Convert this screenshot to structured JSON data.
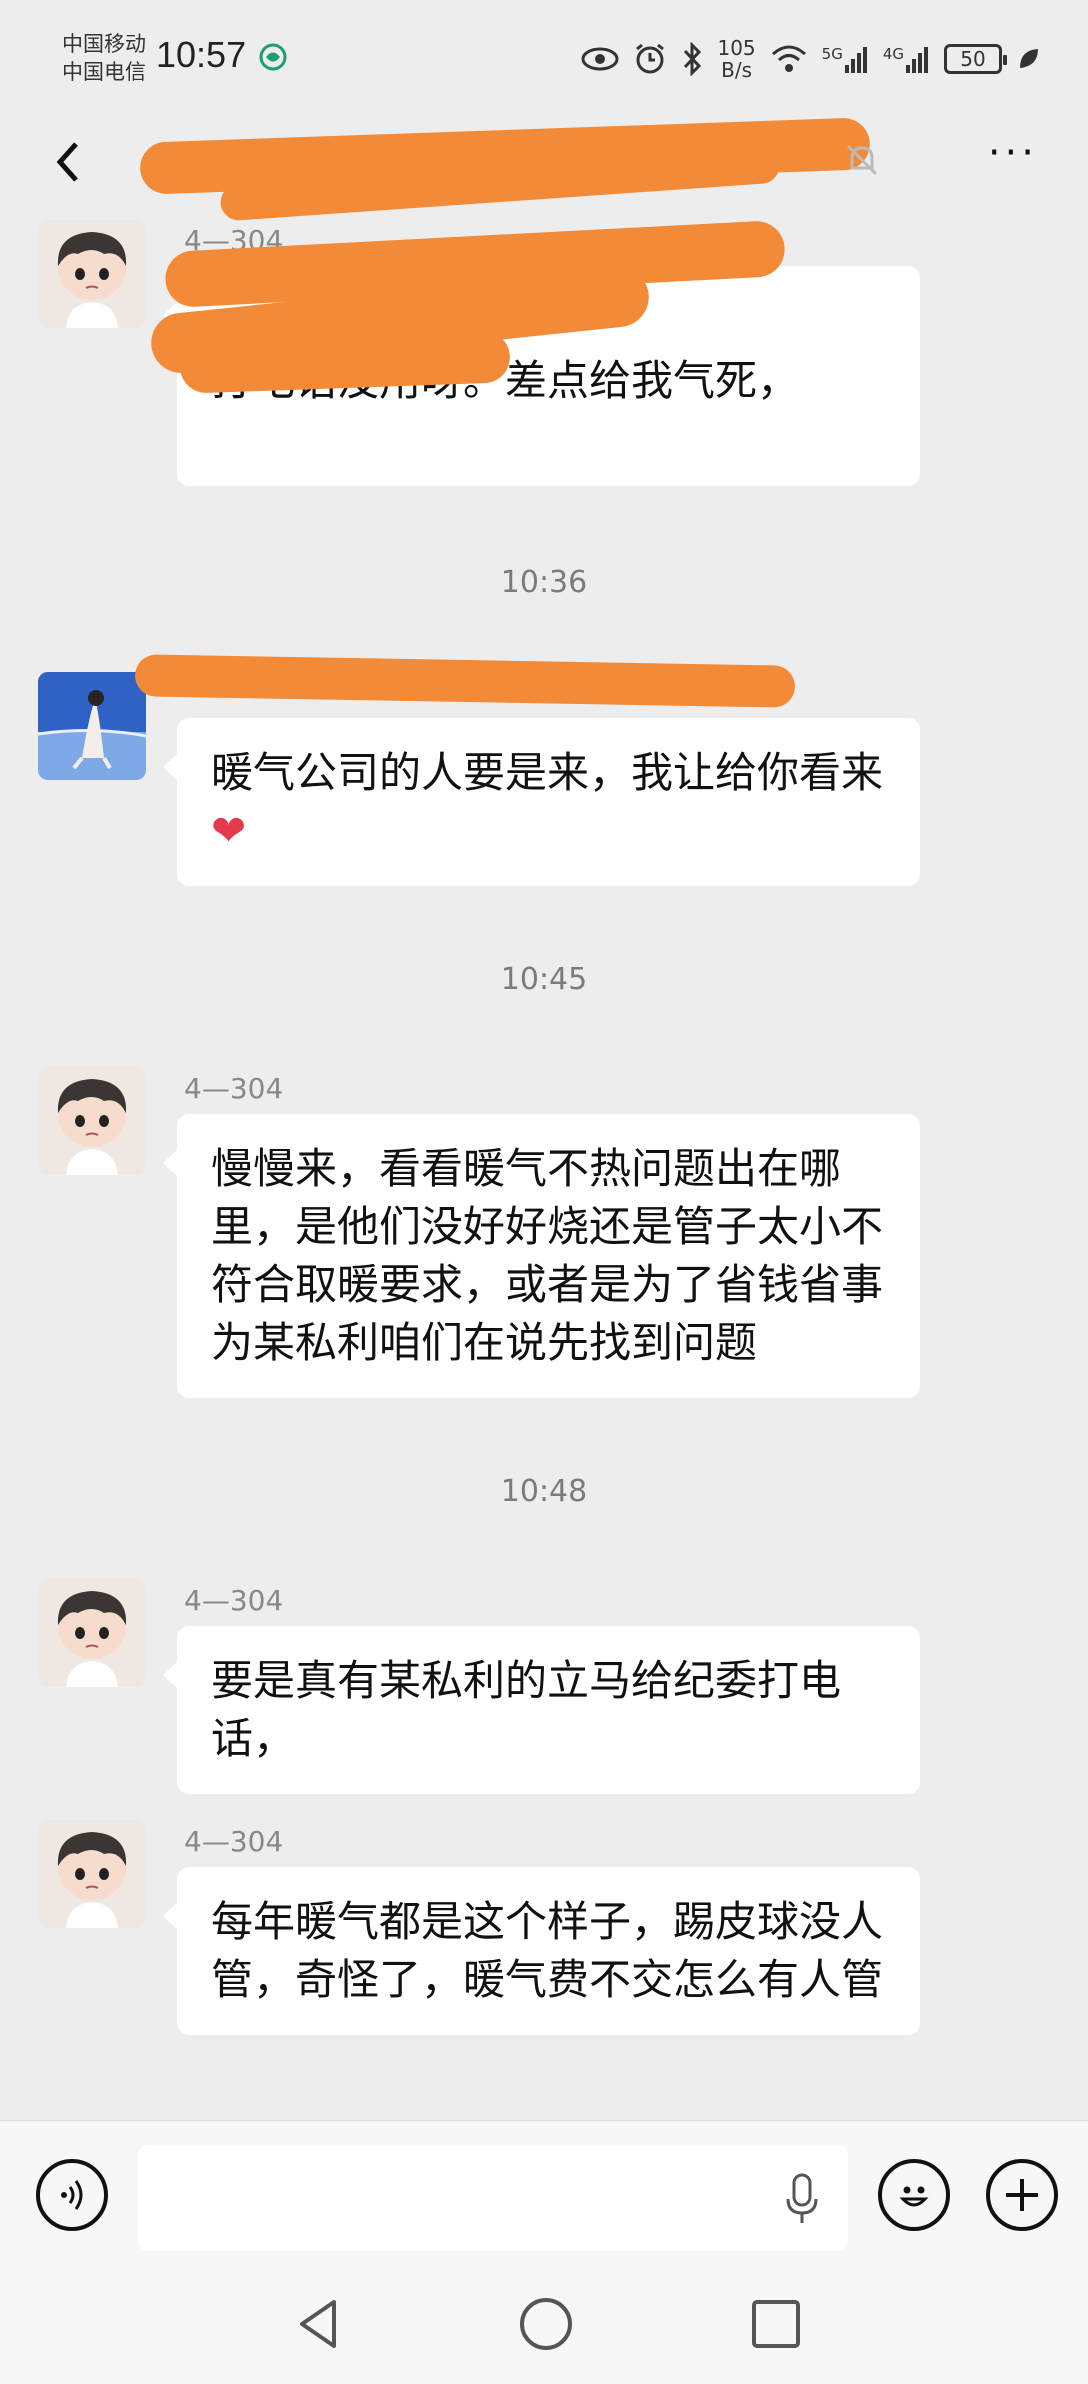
{
  "status_bar": {
    "carrier_1": "中国移动",
    "carrier_2": "中国电信",
    "time": "10:57",
    "speed_value": "105",
    "speed_unit": "B/s",
    "network_1": "5G",
    "network_2": "4G",
    "battery": "50"
  },
  "header": {
    "back_icon": "chevron-left",
    "mute_icon": "bell-off",
    "more_icon": "more-dots"
  },
  "messages": [
    {
      "kind": "msg",
      "sender": "4—304",
      "avatar": "cartoon-boy",
      "text": "打电话没用呀。差点给我气死，"
    },
    {
      "kind": "time",
      "text": "10:36"
    },
    {
      "kind": "msg",
      "sender": "",
      "avatar": "seaside-photo",
      "text": "暖气公司的人要是来，我让给你看来",
      "emoji": "❤"
    },
    {
      "kind": "time",
      "text": "10:45"
    },
    {
      "kind": "msg",
      "sender": "4—304",
      "avatar": "cartoon-boy",
      "text": "慢慢来，看看暖气不热问题出在哪里，是他们没好好烧还是管子太小不符合取暖要求，或者是为了省钱省事为某私利咱们在说先找到问题"
    },
    {
      "kind": "time",
      "text": "10:48"
    },
    {
      "kind": "msg",
      "sender": "4—304",
      "avatar": "cartoon-boy",
      "text": "要是真有某私利的立马给纪委打电话，"
    },
    {
      "kind": "msg",
      "sender": "4—304",
      "avatar": "cartoon-boy",
      "text": "每年暖气都是这个样子，踢皮球没人管，奇怪了，暖气费不交怎么有人管"
    }
  ],
  "input_bar": {
    "voice_icon": "voice-wave",
    "mic_icon": "microphone",
    "emoji_icon": "smiley-face",
    "plus_icon": "plus"
  },
  "nav_bar": {
    "back": "triangle-back",
    "home": "circle-home",
    "recents": "square-recents"
  },
  "colors": {
    "background": "#ededed",
    "bubble": "#ffffff",
    "redaction": "#f28a38",
    "timestamp": "#7b7b7b"
  }
}
